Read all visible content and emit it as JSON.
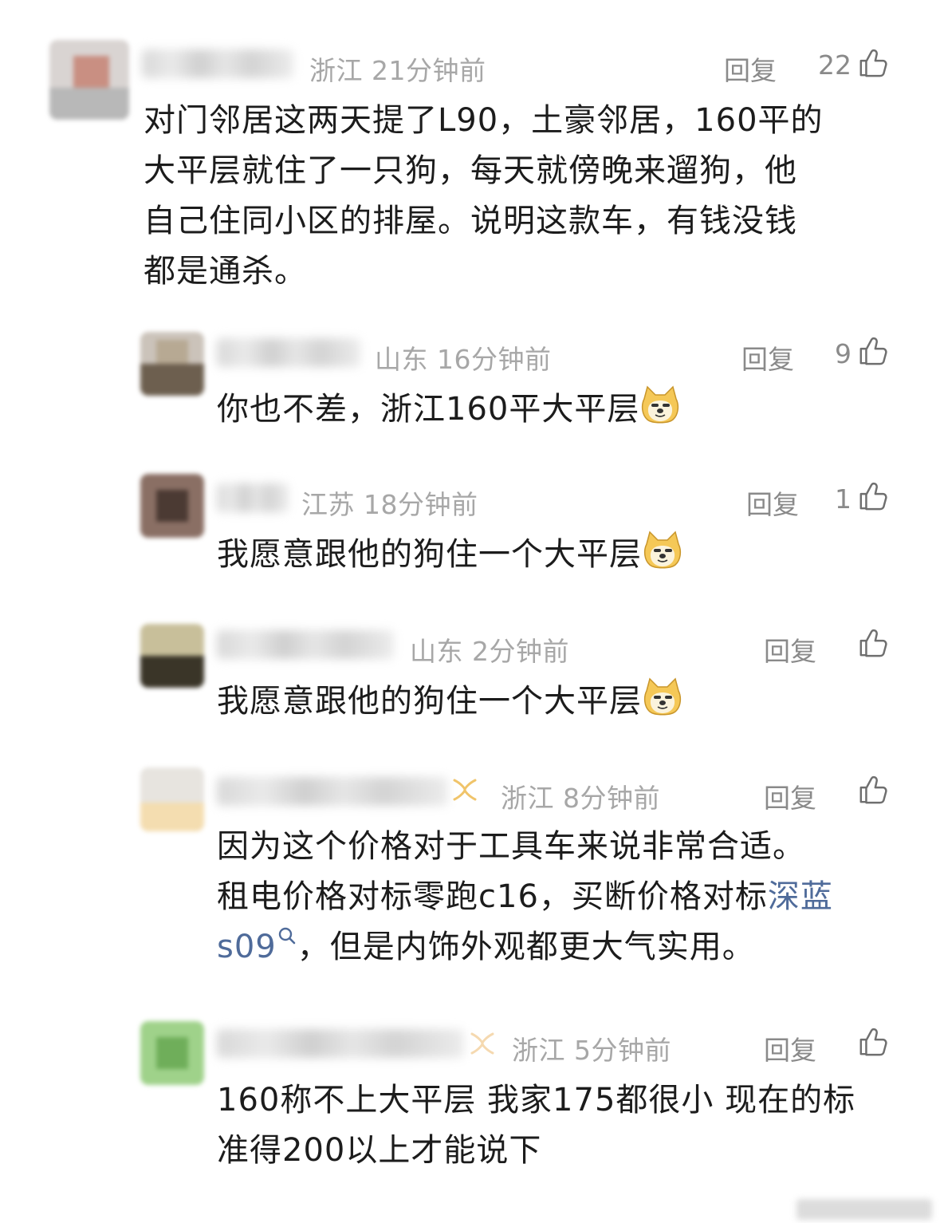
{
  "comments": [
    {
      "location": "浙江",
      "time": "21分钟前",
      "reply": "回复",
      "likes": "22",
      "text_lines": [
        "对门邻居这两天提了L90，土豪邻居，160平的",
        "大平层就住了一只狗，每天就傍晚来遛狗，他",
        "自己住同小区的排屋。说明这款车，有钱没钱",
        "都是通杀。"
      ]
    },
    {
      "location": "山东",
      "time": "16分钟前",
      "reply": "回复",
      "likes": "9",
      "text": "你也不差，浙江160平大平层"
    },
    {
      "location": "江苏",
      "time": "18分钟前",
      "reply": "回复",
      "likes": "1",
      "text": "我愿意跟他的狗住一个大平层"
    },
    {
      "location": "山东",
      "time": "2分钟前",
      "reply": "回复",
      "likes": "",
      "text": "我愿意跟他的狗住一个大平层"
    },
    {
      "location": "浙江",
      "time": "8分钟前",
      "reply": "回复",
      "likes": "",
      "text_line1": "因为这个价格对于工具车来说非常合适。",
      "text_line2_plain": "租电价格对标零跑c16，买断价格对标",
      "link_part1": "深蓝",
      "link_part2": "s09",
      "text_line3_rest": "，但是内饰外观都更大气实用。"
    },
    {
      "location": "浙江",
      "time": "5分钟前",
      "reply": "回复",
      "likes": "",
      "text_lines": [
        "160称不上大平层 我家175都很小 现在的标",
        "准得200以上才能说下"
      ]
    }
  ],
  "icons": {
    "like": "thumbs-up-icon",
    "emoji": "doge-emoji-icon",
    "search": "search-icon"
  },
  "colors": {
    "link": "#4f6b9a",
    "meta": "#a7a7a7",
    "text": "#1c1c1c"
  }
}
